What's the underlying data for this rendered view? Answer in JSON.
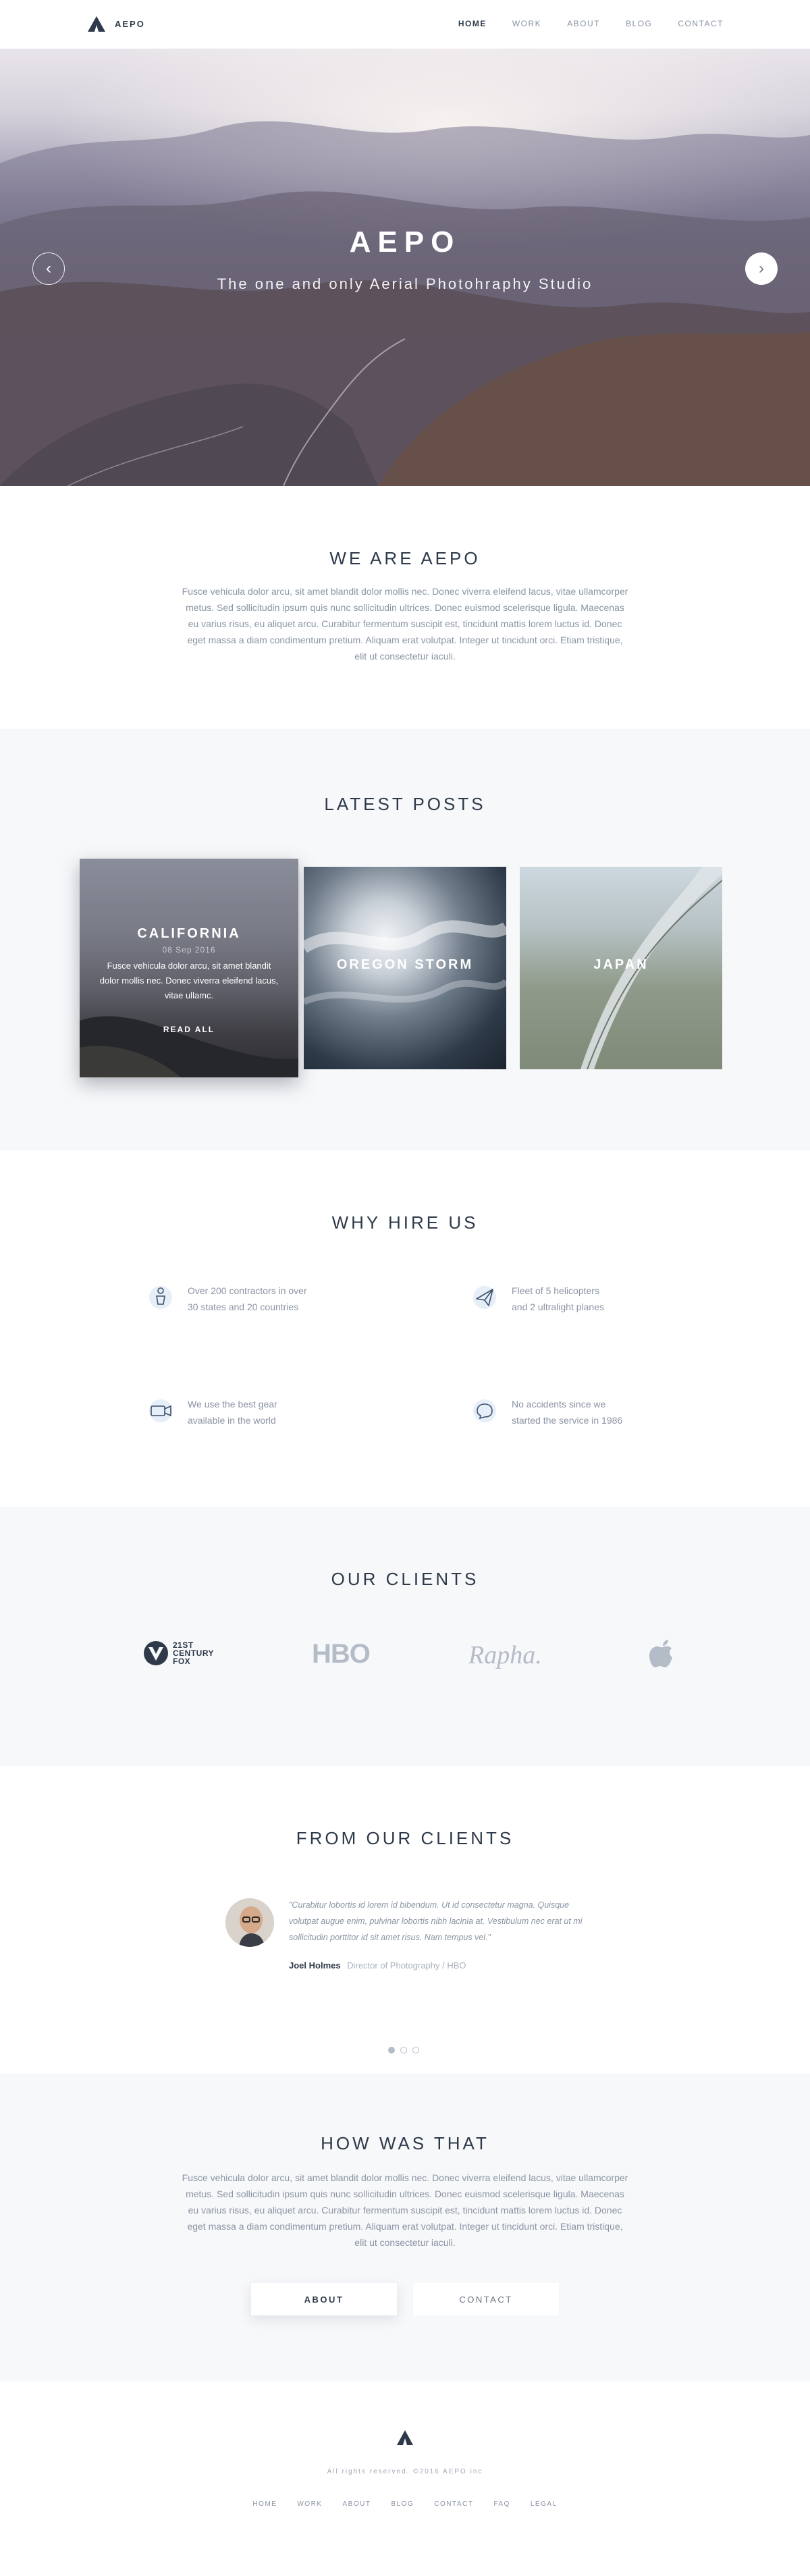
{
  "brand": {
    "name": "AEPO"
  },
  "nav": {
    "items": [
      {
        "label": "HOME"
      },
      {
        "label": "WORK"
      },
      {
        "label": "ABOUT"
      },
      {
        "label": "BLOG"
      },
      {
        "label": "CONTACT"
      }
    ]
  },
  "hero": {
    "title": "AEPO",
    "subtitle": "The one and only Aerial Photohraphy Studio",
    "prev_icon": "chevron-left-icon",
    "next_icon": "chevron-right-icon"
  },
  "about": {
    "title": "WE ARE AEPO",
    "body": "Fusce vehicula dolor arcu, sit amet blandit dolor mollis nec. Donec viverra eleifend lacus, vitae ullamcorper metus. Sed sollicitudin ipsum quis nunc sollicitudin ultrices. Donec euismod scelerisque ligula. Maecenas eu varius risus, eu aliquet arcu. Curabitur fermentum suscipit est, tincidunt mattis lorem luctus id. Donec eget massa a diam condimentum pretium. Aliquam erat volutpat. Integer ut tincidunt orci. Etiam tristique, elit ut consectetur iaculi."
  },
  "posts": {
    "title": "LATEST POSTS",
    "items": [
      {
        "title": "CALIFORNIA",
        "date": "08 Sep 2016",
        "excerpt": "Fusce vehicula dolor arcu, sit amet blandit dolor mollis nec. Donec viverra eleifend lacus, vitae ullamc.",
        "cta": "READ ALL"
      },
      {
        "title": "OREGON STORM"
      },
      {
        "title": "JAPAN"
      }
    ]
  },
  "hire": {
    "title": "WHY HIRE US",
    "features": [
      {
        "icon": "person-icon",
        "line1": "Over 200 contractors in over",
        "line2": "30 states and 20 countries"
      },
      {
        "icon": "plane-icon",
        "line1": "Fleet of 5 helicopters",
        "line2": "and 2 ultralight planes"
      },
      {
        "icon": "camera-icon",
        "line1": "We use the best gear",
        "line2": "available in the world"
      },
      {
        "icon": "chat-bubble-icon",
        "line1": "No accidents since we",
        "line2": "started the service in 1986"
      }
    ]
  },
  "clients": {
    "title": "OUR CLIENTS",
    "logos": [
      {
        "name": "21st-century-fox-logo",
        "line1": "21ST",
        "line2": "CENTURY",
        "line3": "FOX"
      },
      {
        "name": "hbo-logo",
        "text": "HBO"
      },
      {
        "name": "rapha-logo",
        "text": "Rapha."
      },
      {
        "name": "apple-logo",
        "text": ""
      }
    ]
  },
  "testimonials": {
    "title": "FROM OUR CLIENTS",
    "quote": "\"Curabitur lobortis id lorem id bibendum. Ut id consectetur magna. Quisque volutpat augue enim, pulvinar lobortis nibh lacinia at. Vestibulum nec erat ut mi sollicitudin porttitor id sit amet risus. Nam tempus vel.\"",
    "author_name": "Joel Holmes",
    "author_role": "Director of Photography / HBO",
    "active_slide": 1,
    "slide_count": 3
  },
  "how": {
    "title": "HOW WAS THAT",
    "body": "Fusce vehicula dolor arcu, sit amet blandit dolor mollis nec. Donec viverra eleifend lacus, vitae ullamcorper metus. Sed sollicitudin ipsum quis nunc sollicitudin ultrices. Donec euismod scelerisque ligula. Maecenas eu varius risus, eu aliquet arcu. Curabitur fermentum suscipit est, tincidunt mattis lorem luctus id. Donec eget massa a diam condimentum pretium. Aliquam erat volutpat. Integer ut tincidunt orci. Etiam tristique, elit ut consectetur iaculi.",
    "primary_button": "ABOUT",
    "secondary_button": "CONTACT"
  },
  "footer": {
    "copyright": "All rights reserved. ©2016 AEPO inc",
    "links": [
      {
        "label": "HOME"
      },
      {
        "label": "WORK"
      },
      {
        "label": "ABOUT"
      },
      {
        "label": "BLOG"
      },
      {
        "label": "CONTACT"
      },
      {
        "label": "FAQ"
      },
      {
        "label": "LEGAL"
      }
    ]
  },
  "colors": {
    "text_dark": "#2e3a4a",
    "text_muted": "#8a94a3",
    "section_alt_bg": "#f7f8fa",
    "accent_icon": "#3c4f6a"
  }
}
